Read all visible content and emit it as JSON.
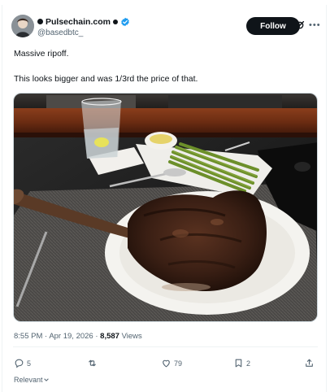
{
  "tweet": {
    "author": {
      "display_name": "Pulsechain.com",
      "handle": "@basedbtc_",
      "verified": true
    },
    "follow_label": "Follow",
    "text_lines": [
      "Massive ripoff.",
      "This looks bigger and was 1/3rd the price of that."
    ],
    "meta": {
      "time": "8:55 PM",
      "date": "Apr 19, 2026",
      "views_count": "8,587",
      "views_label": "Views"
    },
    "actions": {
      "replies": "5",
      "reposts": "",
      "likes": "79",
      "bookmarks": "2"
    },
    "sort_label": "Relevant"
  },
  "icons": {
    "verified": "verified-badge-icon",
    "grok": "grok-icon",
    "more": "more-icon",
    "reply": "reply-icon",
    "repost": "repost-icon",
    "like": "like-icon",
    "bookmark": "bookmark-icon",
    "share": "share-icon"
  },
  "colors": {
    "accent": "#1d9bf0",
    "text": "#0f1419",
    "muted": "#536471",
    "follow_bg": "#0f1419"
  }
}
